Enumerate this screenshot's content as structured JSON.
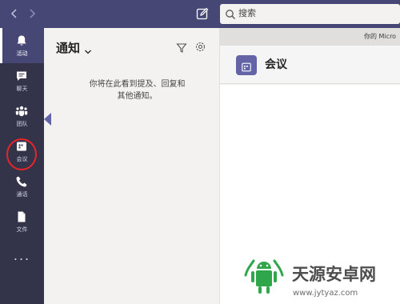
{
  "topbar": {
    "back_icon": "chevron-left-icon",
    "forward_icon": "chevron-right-icon",
    "compose_icon": "compose-icon",
    "search_icon": "search-icon",
    "search_placeholder": "搜索"
  },
  "rail": {
    "items": [
      {
        "label": "活动",
        "icon": "bell-icon",
        "active": true
      },
      {
        "label": "聊天",
        "icon": "chat-icon",
        "active": false
      },
      {
        "label": "团队",
        "icon": "teams-icon",
        "active": false
      },
      {
        "label": "会议",
        "icon": "calendar-icon",
        "active": false,
        "highlighted": true
      },
      {
        "label": "通话",
        "icon": "phone-icon",
        "active": false
      },
      {
        "label": "文件",
        "icon": "file-icon",
        "active": false
      }
    ],
    "more_label": "..."
  },
  "panel": {
    "title": "通知",
    "message_line1": "你将在此看到提及、回复和",
    "message_line2": "其他通知。"
  },
  "content": {
    "banner_text": "你的 Micro",
    "title": "会议"
  },
  "watermark": {
    "title": "天源安卓网",
    "url": "www.jytyaz.com"
  },
  "colors": {
    "topbar": "#464775",
    "rail": "#33344a",
    "accent": "#6264a7",
    "highlight": "#e8242b",
    "watermark_green": "#2fa64a"
  }
}
